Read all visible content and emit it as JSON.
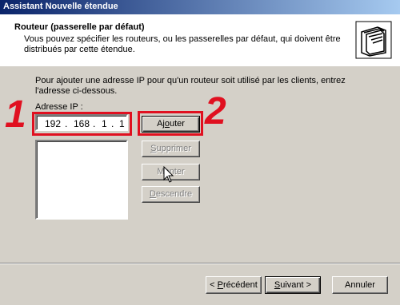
{
  "window": {
    "title": "Assistant Nouvelle étendue"
  },
  "header": {
    "title": "Routeur (passerelle par défaut)",
    "description": "Vous pouvez spécifier les routeurs, ou les passerelles par défaut, qui doivent être distribués par cette étendue.",
    "icon": "folder-stack-icon"
  },
  "content": {
    "intro": "Pour ajouter une adresse IP pour qu'un routeur soit utilisé par les clients, entrez l'adresse ci-dessous.",
    "ip_label": "Adresse IP :",
    "ip_octets": [
      "192",
      "168",
      "1",
      "1"
    ],
    "router_list": []
  },
  "buttons": {
    "add": {
      "label_pre": "Aj",
      "label_u": "o",
      "label_post": "uter"
    },
    "remove": {
      "label_pre": "",
      "label_u": "S",
      "label_post": "upprimer"
    },
    "up": {
      "label_pre": "M",
      "label_u": "o",
      "label_post": "nter"
    },
    "down": {
      "label_pre": "",
      "label_u": "D",
      "label_post": "escendre"
    },
    "back": {
      "label_pre": "< ",
      "label_u": "P",
      "label_post": "récédent"
    },
    "next": {
      "label_pre": "",
      "label_u": "S",
      "label_post": "uivant >"
    },
    "cancel": {
      "label": "Annuler"
    }
  },
  "annotations": {
    "one": "1",
    "two": "2"
  },
  "colors": {
    "annotation_red": "#e01020",
    "title_bar_start": "#0a246a",
    "title_bar_end": "#a6caf0"
  }
}
